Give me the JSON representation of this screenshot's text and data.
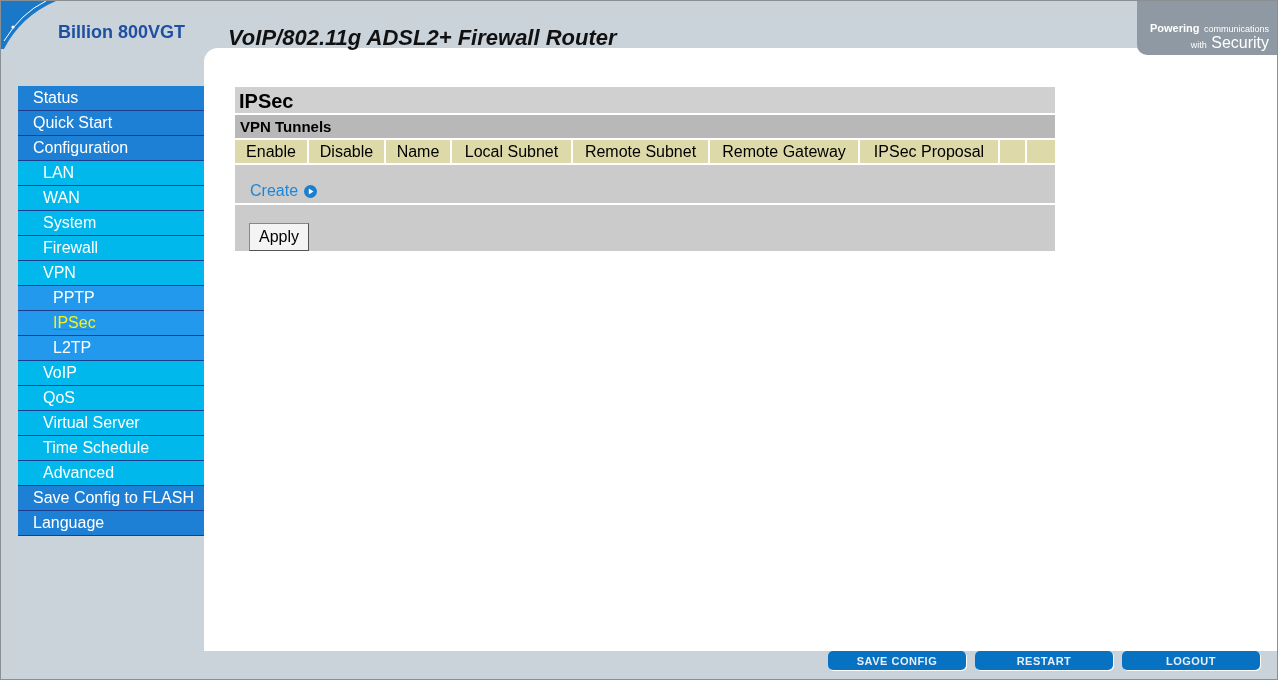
{
  "header": {
    "product": "Billion 800VGT",
    "title": "VoIP/802.11g ADSL2+ Firewall Router",
    "slogan_top": "Powering",
    "slogan_small": "communications",
    "slogan_with": "with",
    "slogan_big": "Security"
  },
  "menu": [
    {
      "label": "Status",
      "selected": false
    },
    {
      "label": "Quick Start",
      "selected": false
    },
    {
      "label": "Configuration",
      "selected": false,
      "children": [
        {
          "label": "LAN",
          "selected": false
        },
        {
          "label": "WAN",
          "selected": false
        },
        {
          "label": "System",
          "selected": false
        },
        {
          "label": "Firewall",
          "selected": false
        },
        {
          "label": "VPN",
          "selected": false,
          "children": [
            {
              "label": "PPTP",
              "selected": false
            },
            {
              "label": "IPSec",
              "selected": true
            },
            {
              "label": "L2TP",
              "selected": false
            }
          ]
        },
        {
          "label": "VoIP",
          "selected": false
        },
        {
          "label": "QoS",
          "selected": false
        },
        {
          "label": "Virtual Server",
          "selected": false
        },
        {
          "label": "Time Schedule",
          "selected": false
        },
        {
          "label": "Advanced",
          "selected": false
        }
      ]
    },
    {
      "label": "Save Config to FLASH",
      "selected": false
    },
    {
      "label": "Language",
      "selected": false
    }
  ],
  "page": {
    "title": "IPSec",
    "section": "VPN Tunnels",
    "columns": [
      "Enable",
      "Disable",
      "Name",
      "Local Subnet",
      "Remote Subnet",
      "Remote Gateway",
      "IPSec Proposal"
    ],
    "create_link": "Create",
    "apply_button": "Apply"
  },
  "footer_buttons": [
    "SAVE CONFIG",
    "RESTART",
    "LOGOUT"
  ]
}
